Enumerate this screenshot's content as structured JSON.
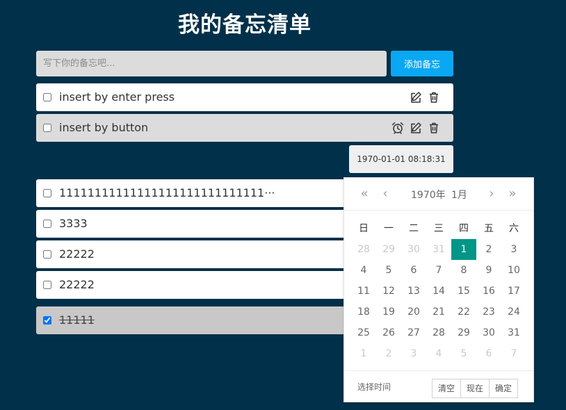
{
  "title": "我的备忘清单",
  "add": {
    "placeholder": "写下你的备忘吧...",
    "button_label": "添加备忘"
  },
  "items": [
    {
      "text": "insert by enter press",
      "checked": false
    },
    {
      "text": "insert by button",
      "checked": false
    },
    {
      "text": "11111111111111111111111111111···",
      "checked": false
    },
    {
      "text": "3333",
      "checked": false
    },
    {
      "text": "22222",
      "checked": false
    },
    {
      "text": "22222",
      "checked": false
    },
    {
      "text": "11111",
      "checked": true
    }
  ],
  "reminder_time": "1970-01-01 08:18:31",
  "icons": {
    "edit": "edit-icon",
    "delete": "trash-icon",
    "alarm": "alarm-clock-icon"
  },
  "datepicker": {
    "prev_year": "«",
    "prev_month": "‹",
    "next_month": "›",
    "next_year": "»",
    "year_label": "1970年",
    "month_label": "1月",
    "weekdays": [
      "日",
      "一",
      "二",
      "三",
      "四",
      "五",
      "六"
    ],
    "weeks": [
      [
        "28",
        "29",
        "30",
        "31",
        "1",
        "2",
        "3"
      ],
      [
        "4",
        "5",
        "6",
        "7",
        "8",
        "9",
        "10"
      ],
      [
        "11",
        "12",
        "13",
        "14",
        "15",
        "16",
        "17"
      ],
      [
        "18",
        "19",
        "20",
        "21",
        "22",
        "23",
        "24"
      ],
      [
        "25",
        "26",
        "27",
        "28",
        "29",
        "30",
        "31"
      ],
      [
        "1",
        "2",
        "3",
        "4",
        "5",
        "6",
        "7"
      ]
    ],
    "selected_day": "1",
    "choose_time": "选择时间",
    "clear": "清空",
    "now": "现在",
    "confirm": "确定"
  },
  "colors": {
    "background": "#01304a",
    "accent": "#0aa7f2",
    "selected": "#009688"
  }
}
